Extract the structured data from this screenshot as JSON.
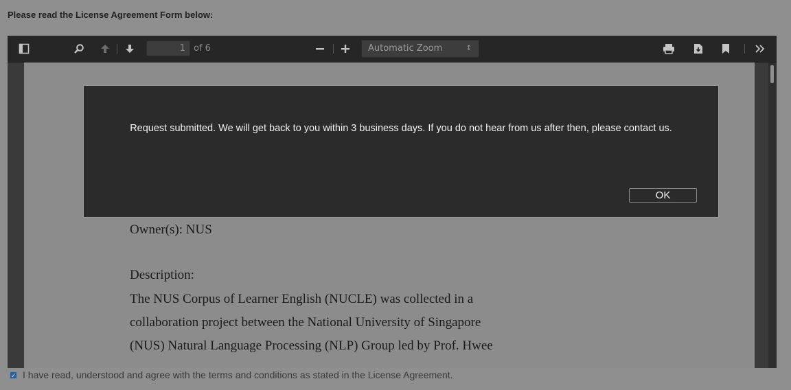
{
  "page": {
    "heading": "Please read the License Agreement Form below:",
    "agree_label": "I have read, understood and agree with the terms and conditions as stated in the License Agreement.",
    "agree_checked": true
  },
  "viewer": {
    "toolbar": {
      "sidebar_icon": "sidebar-toggle-icon",
      "search_icon": "search-icon",
      "prev_icon": "arrow-up-icon",
      "next_icon": "arrow-down-icon",
      "page_number": "1",
      "page_of": "of 6",
      "zoom_out_icon": "minus-icon",
      "zoom_in_icon": "plus-icon",
      "zoom_value": "Automatic Zoom",
      "print_icon": "print-icon",
      "download_icon": "download-icon",
      "bookmark_icon": "bookmark-icon",
      "tools_icon": "double-chevron-right-icon"
    },
    "document": {
      "owner": "Owner(s): NUS",
      "description_title": "Description:",
      "lines": [
        "The NUS Corpus of Learner English (NUCLE) was collected in a",
        "collaboration project between the National University of Singapore",
        "(NUS) Natural Language Processing (NLP) Group led by Prof. Hwee"
      ]
    }
  },
  "dialog": {
    "message": "Request submitted. We will get back to you within 3 business days. If you do not hear from us after then, please contact us.",
    "ok_label": "OK"
  }
}
